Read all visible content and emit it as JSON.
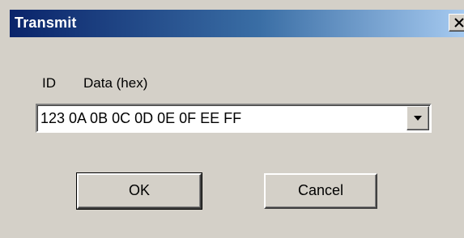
{
  "window": {
    "title": "Transmit",
    "close_icon": "close-icon"
  },
  "labels": {
    "id": "ID",
    "data": "Data (hex)"
  },
  "message_combo": {
    "value": "123  0A 0B 0C 0D 0E 0F EE FF",
    "dropdown_icon": "chevron-down-icon"
  },
  "buttons": {
    "ok": "OK",
    "cancel": "Cancel"
  }
}
